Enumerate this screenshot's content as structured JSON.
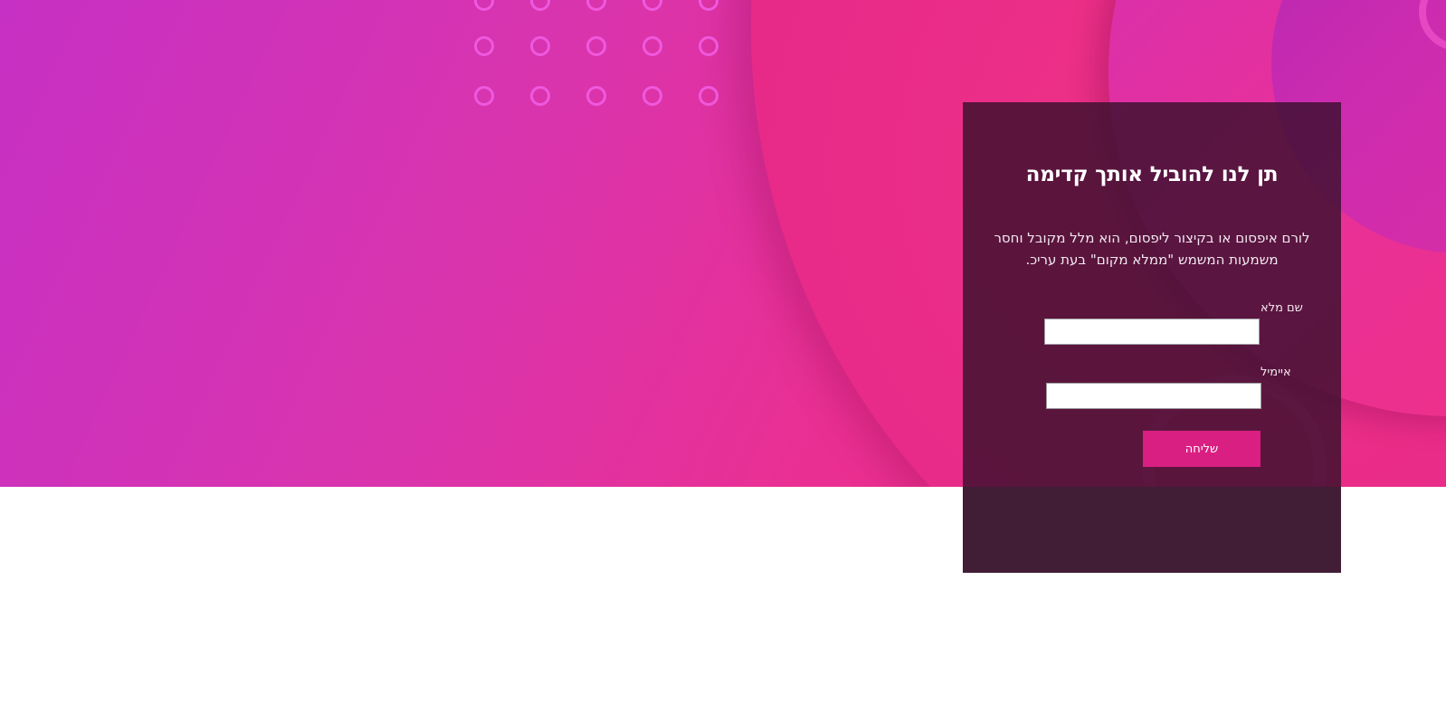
{
  "hero": {
    "background_colors": [
      "#c630c4",
      "#e72a88",
      "#ef2d86"
    ]
  },
  "contact_form": {
    "title": "תן לנו להוביל אותך קדימה",
    "description": "לורם איפסום או בקיצור ליפסום, הוא מלל מקובל וחסר משמעות המשמש \"ממלא מקום\" בעת עריכ.",
    "full_name_label": "שם מלא",
    "full_name_value": "",
    "email_label": "איימיל",
    "email_value": "",
    "submit_label": "שליחה"
  },
  "colors": {
    "panel_background": "#3a102d",
    "button": "#d91f82",
    "dot_ring": "#f15de3",
    "footer_panel": "#5d5d5d"
  }
}
